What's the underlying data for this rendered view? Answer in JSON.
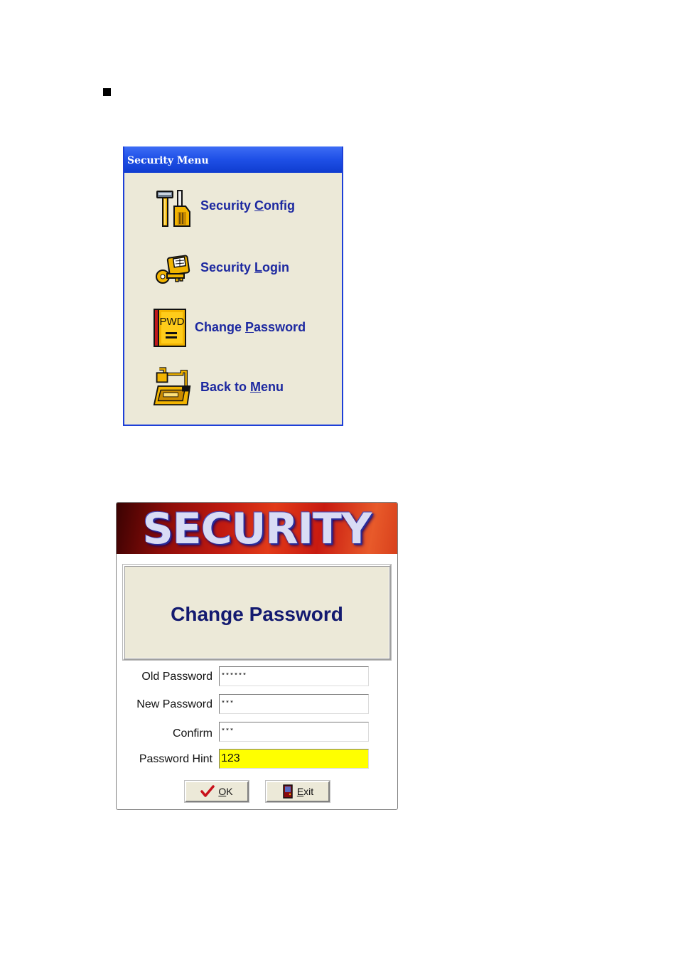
{
  "security_menu": {
    "title": "Security Menu",
    "items": [
      {
        "pre": "Security ",
        "accel": "C",
        "post": "onfig",
        "icon": "tools-icon"
      },
      {
        "pre": "Security ",
        "accel": "L",
        "post": "ogin",
        "icon": "key-card-icon"
      },
      {
        "pre": "Change ",
        "accel": "P",
        "post": "assword",
        "icon": "pwd-book-icon",
        "icon_text": "PWD"
      },
      {
        "pre": "Back to ",
        "accel": "M",
        "post": "enu",
        "icon": "return-arrow-icon"
      }
    ]
  },
  "security_dialog": {
    "banner": "SECURITY",
    "heading": "Change Password",
    "fields": [
      {
        "label": "Old Password",
        "value": "******"
      },
      {
        "label": "New Password",
        "value": "***"
      },
      {
        "label": "Confirm",
        "value": "***"
      },
      {
        "label": "Password Hint",
        "value": "123"
      }
    ],
    "ok_button": {
      "pre": "",
      "accel": "O",
      "post": "K",
      "icon": "checkmark-icon"
    },
    "exit_button": {
      "pre": "",
      "accel": "E",
      "post": "xit",
      "icon": "exit-door-icon"
    }
  },
  "colors": {
    "title_bar": "#1e4fe6",
    "menu_text": "#1c28a0",
    "heading_text": "#131a70",
    "hint_field": "#ffff00",
    "banner_red": "#c01a10"
  }
}
